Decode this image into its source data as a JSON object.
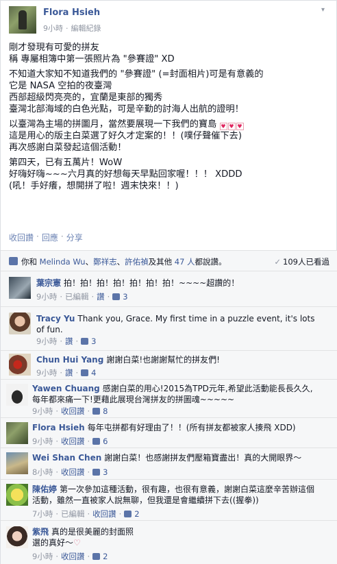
{
  "post": {
    "author": "Flora Hsieh",
    "time": "9小時",
    "separator": "·",
    "edit_label": "編輯紀錄",
    "body": [
      [
        "剛才發現有可愛的拼友",
        "稱 專屬相簿中第一張照片為 \"參賽證\" XD"
      ],
      [
        "不知道大家知不知道我們的 \"參賽證\" (=封面相片)可是有意義的",
        "它是 NASA 空拍的夜臺灣",
        "西部超級閃亮亮的，宜蘭是東部的獨秀",
        "臺灣北部海域的白色光點，可是辛勤的討海人出航的證明！"
      ],
      [
        "以臺灣為主場的拼圖月，當然要展現一下我們的寶島",
        "這是用心的版主白菜選了好久才定案的！！(噗仔聲催下去)",
        "再次感謝白菜發起這個活動！"
      ],
      [
        "第四天，已有五萬片！WoW",
        "好嗨好嗨~~~六月真的好想每天早點回家喔！！！ XDDD",
        "(吼！手好癢，想開拼了啦！週末快來！！)"
      ]
    ],
    "actions": [
      "收回讚",
      "回應",
      "分享"
    ],
    "actions_sep": "·"
  },
  "likes": {
    "prefix": "你和",
    "names": [
      "Melinda Wu",
      "鄭祥志",
      "許佑禎"
    ],
    "mid": "及其他",
    "others": "47 人",
    "suffix": "都說讚。",
    "seen": "109人已看過"
  },
  "comments": [
    {
      "name": "葉宗憲",
      "text": "拍！拍！拍！拍！拍！拍！拍！~~~~超讚的！",
      "meta": [
        "9小時",
        "已編輯",
        "讚"
      ],
      "likes": "3"
    },
    {
      "name": "Tracy Yu",
      "text": "Thank you, Grace. My first time in a puzzle event, it's lots of fun.",
      "meta": [
        "9小時",
        "讚"
      ],
      "likes": "3"
    },
    {
      "name": "Chun Hui Yang",
      "text": "謝謝白菜!也謝謝幫忙的拼友們!",
      "meta": [
        "9小時",
        "讚"
      ],
      "likes": "4"
    },
    {
      "name": "Yawen Chuang",
      "text": "感謝白菜的用心!2015為TPD元年,希望此活動能長長久久,每年都來痛一下!更藉此展現台灣拼友的拼圖魂~~~~~",
      "meta": [
        "9小時",
        "收回讚"
      ],
      "likes": "8"
    },
    {
      "name": "Flora Hsieh",
      "text": "每年屯拼都有好理由了！！(所有拼友都被家人揍飛 XDD)",
      "meta": [
        "9小時",
        "收回讚"
      ],
      "likes": "6"
    },
    {
      "name": "Wei Shan Chen",
      "text": "謝謝白菜！也感謝拼友們壓箱寶盡出！真的大開眼界～",
      "meta": [
        "8小時",
        "收回讚"
      ],
      "likes": "3"
    },
    {
      "name": "陳佑婷",
      "text": "第一次參加這種活動，很有趣，也很有意義，謝謝白菜這麼辛苦辦這個活動，雖然一直被家人說無聊，但我還是會繼續拼下去((握拳))",
      "meta": [
        "7小時",
        "已編輯",
        "收回讚"
      ],
      "likes": "2"
    },
    {
      "name": "紫飛",
      "text": "真的是很美麗的封面照選的真好～",
      "meta": [
        "9小時",
        "收回讚"
      ],
      "likes": "2"
    }
  ],
  "meta_sep": "·",
  "icons": {
    "avatar_bg": "#5d6b4a",
    "link_color": "#3b5998",
    "muted_color": "#9197a3",
    "comment_bg": "#f6f7f8"
  }
}
